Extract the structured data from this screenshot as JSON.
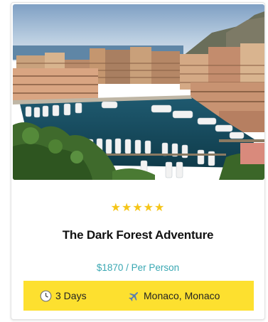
{
  "tour": {
    "rating_stars": 5,
    "title": "The Dark Forest Adventure",
    "price": "$1870 / Per Person",
    "duration": "3 Days",
    "location": "Monaco, Monaco"
  },
  "icons": {
    "star": "star-icon",
    "duration": "clock-icon",
    "location": "airplane-icon"
  },
  "colors": {
    "star": "#f5c518",
    "price": "#3aa8b3",
    "info_bar": "#fde02f"
  }
}
